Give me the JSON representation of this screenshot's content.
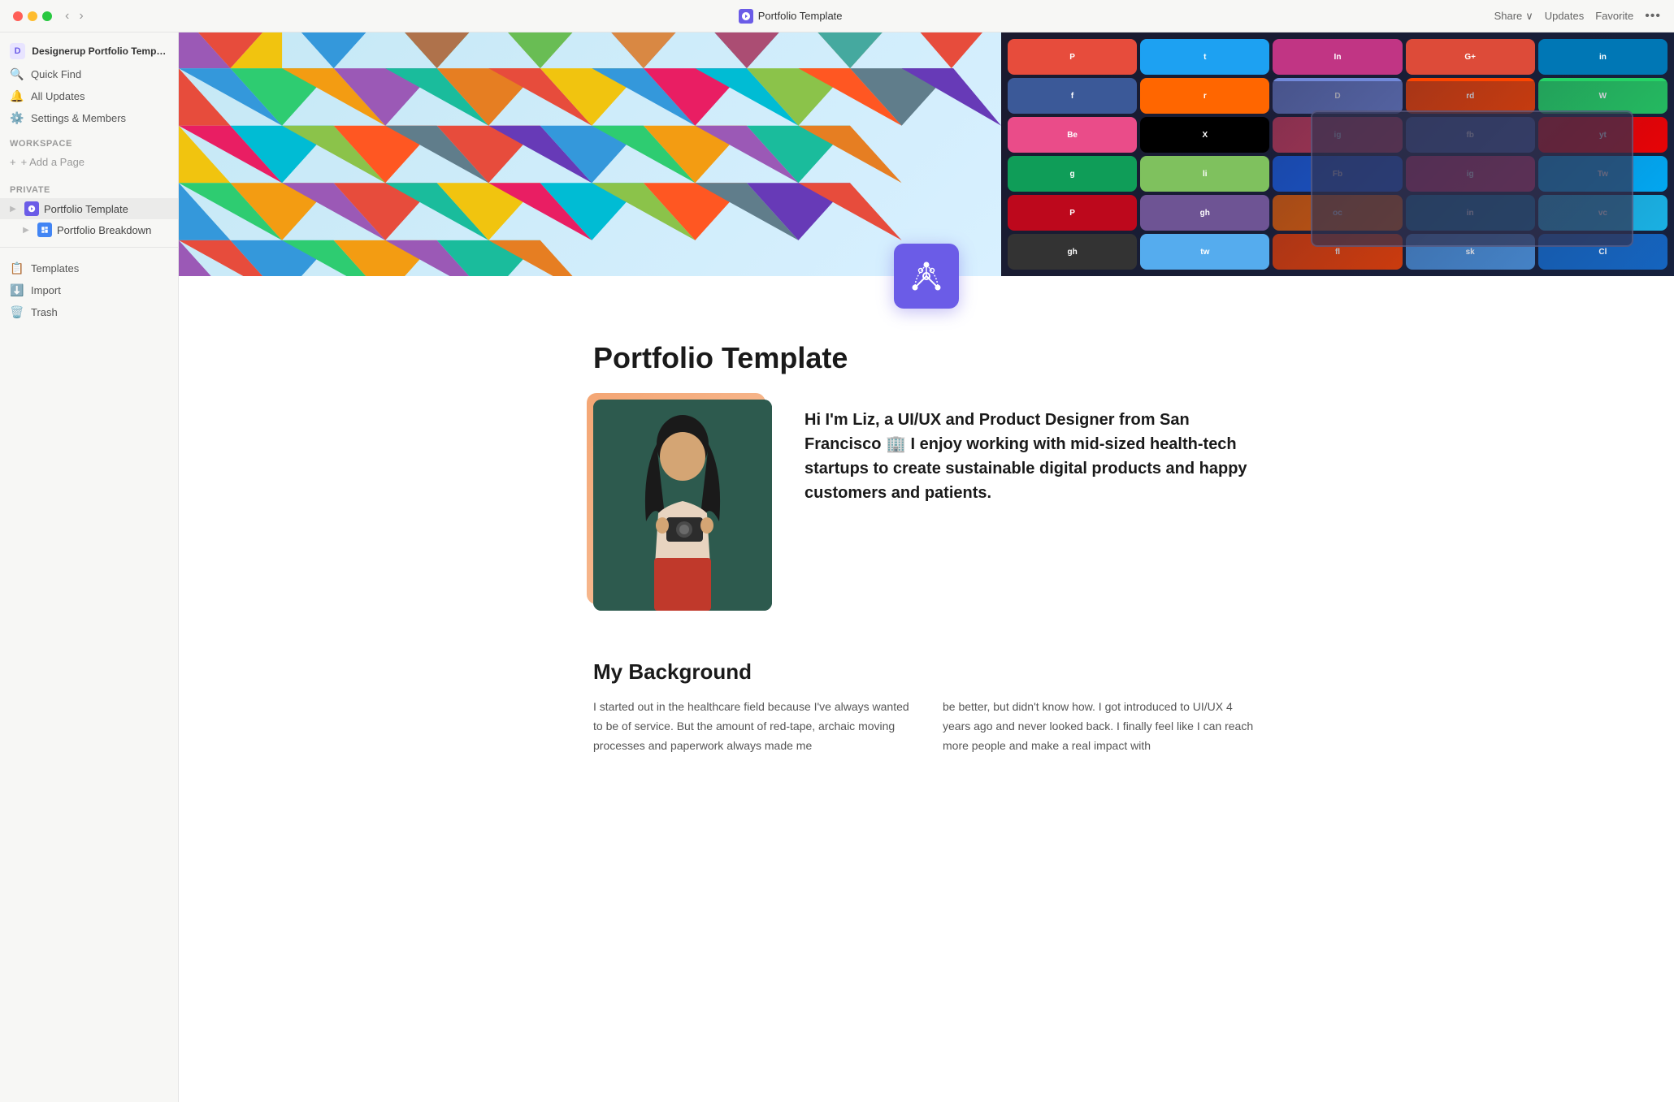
{
  "titlebar": {
    "title": "Portfolio Template",
    "share_label": "Share",
    "updates_label": "Updates",
    "favorite_label": "Favorite"
  },
  "sidebar": {
    "workspace_name": "Designerup Portfolio Template",
    "nav_items": [
      {
        "label": "Quick Find",
        "icon": "🔍"
      },
      {
        "label": "All Updates",
        "icon": "🔔"
      },
      {
        "label": "Settings & Members",
        "icon": "⚙️"
      }
    ],
    "workspace_section": "WORKSPACE",
    "add_page_label": "+ Add a Page",
    "private_section": "PRIVATE",
    "private_pages": [
      {
        "label": "Portfolio Template",
        "icon_type": "purple",
        "expanded": false
      },
      {
        "label": "Portfolio Breakdown",
        "icon_type": "blue",
        "expanded": false
      }
    ],
    "bottom_items": [
      {
        "label": "Templates",
        "icon": "📋"
      },
      {
        "label": "Import",
        "icon": "⬇️"
      },
      {
        "label": "Trash",
        "icon": "🗑️"
      }
    ]
  },
  "page": {
    "title": "Portfolio Template",
    "icon_label": "design-icon",
    "hero_alt": "Colorful header image",
    "profile_bio": "Hi I'm Liz, a UI/UX and Product Designer from San Francisco 🏢 I enjoy working with mid-sized health-tech startups to create sustainable digital products and happy customers and patients.",
    "background_heading": "My Background",
    "background_col1": "I started out in the healthcare field because I've always wanted to be of service. But the amount of red-tape, archaic moving processes and paperwork always made me",
    "background_col2": "be better, but didn't know how. I got introduced to UI/UX 4 years ago and never looked back. I finally feel like I can reach more people and make a real impact with"
  },
  "social_colors": [
    "#e74c3c",
    "#3498db",
    "#e91e63",
    "#9c27b0",
    "#ff5722",
    "#2196f3",
    "#4caf50",
    "#ff9800",
    "#607d8b",
    "#009688",
    "#673ab7",
    "#f44336",
    "#00bcd4",
    "#8bc34a",
    "#795548",
    "#03a9f4",
    "#cddc39",
    "#ff5722",
    "#9e9e9e",
    "#3f51b5",
    "#e91e63",
    "#009688",
    "#ff9800",
    "#4caf50",
    "#2196f3",
    "#f44336",
    "#9c27b0",
    "#607d8b",
    "#00bcd4",
    "#673ab7"
  ],
  "triangle_colors": [
    "#e74c3c",
    "#3498db",
    "#2ecc71",
    "#f39c12",
    "#9b59b6",
    "#1abc9c",
    "#e67e22",
    "#e74c3c",
    "#f1c40f",
    "#3498db",
    "#e91e63",
    "#00bcd4",
    "#ff5722",
    "#607d8b",
    "#8bc34a",
    "#673ab7",
    "#e74c3c",
    "#2196f3",
    "#4caf50",
    "#ff9800",
    "#9c27b0",
    "#009688",
    "#f44336",
    "#3f51b5",
    "#1abc9c",
    "#e67e22",
    "#9b59b6",
    "#3498db",
    "#2ecc71",
    "#f39c12",
    "#e74c3c",
    "#00bcd4",
    "#ff5722",
    "#607d8b",
    "#8bc34a",
    "#e91e63",
    "#673ab7",
    "#f1c40f",
    "#3498db",
    "#2ecc71"
  ]
}
